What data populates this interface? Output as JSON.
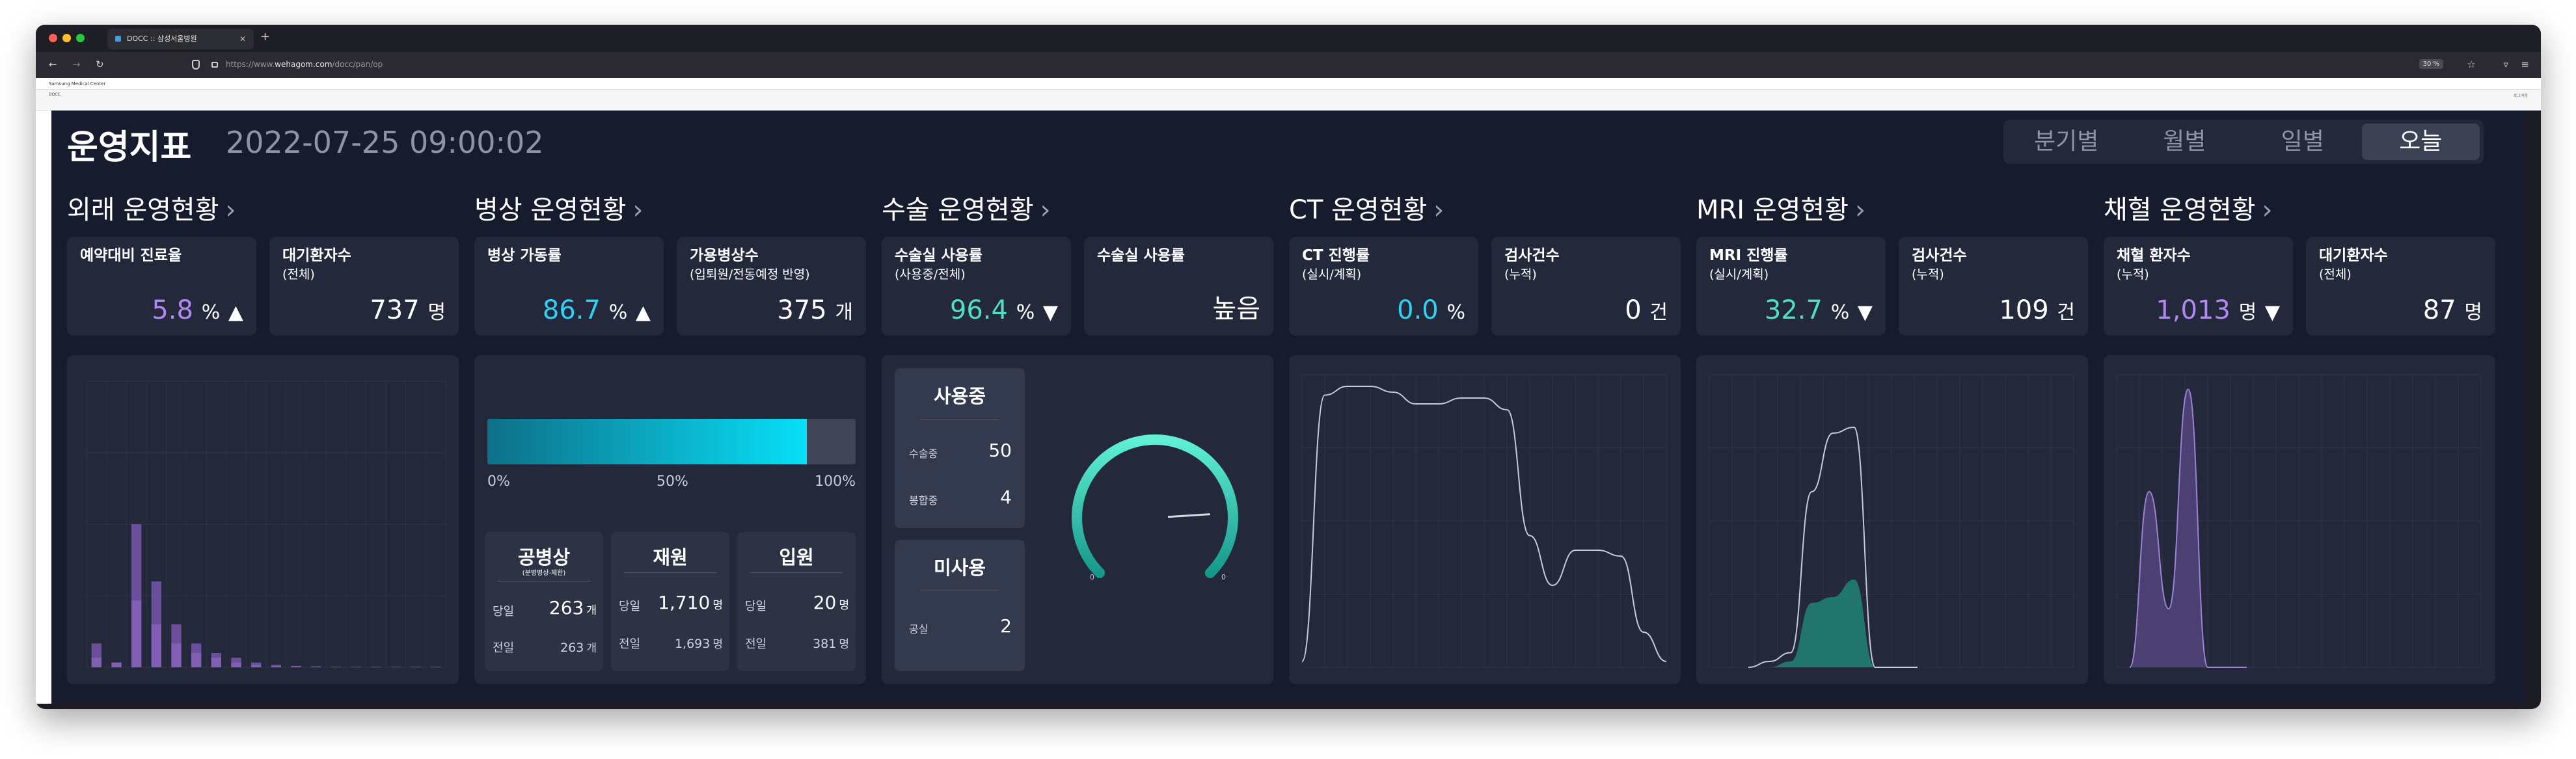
{
  "browser": {
    "tab_title": "DOCC :: 삼성서울병원",
    "url_prefix": "https://www.",
    "url_domain": "wehagom.com",
    "url_path": "/docc/pan/op",
    "zoom": "30 %"
  },
  "strips": {
    "top_left": "Samsung Medical Center",
    "sub_left": "DOCC",
    "sub_right": "로그아웃"
  },
  "header": {
    "title": "운영지표",
    "datetime": "2022-07-25 09:00:02",
    "periods": [
      "분기별",
      "월별",
      "일별",
      "오늘"
    ],
    "active_period": "오늘"
  },
  "sections": {
    "outpatient": {
      "title": "외래 운영현황",
      "card1": {
        "label": "예약대비 진료율",
        "value": "5.8",
        "unit": "%",
        "trend": "▲"
      },
      "card2": {
        "label": "대기환자수",
        "sub": "(전체)",
        "value": "737",
        "unit": "명"
      }
    },
    "ward": {
      "title": "병상 운영현황",
      "card1": {
        "label": "병상 가동률",
        "value": "86.7",
        "unit": "%",
        "trend": "▲"
      },
      "card2": {
        "label": "가용병상수",
        "sub": "(입퇴원/전동예정 반영)",
        "value": "375",
        "unit": "개"
      },
      "bar": {
        "value_pct": 86.7,
        "labels": [
          "0%",
          "50%",
          "100%"
        ]
      },
      "boxes": [
        {
          "title": "공병상",
          "subtitle": "(분병병상-제한)",
          "row1_label": "당일",
          "row1_value": "263",
          "row1_unit": "개",
          "row2_label": "전일",
          "row2_value": "263",
          "row2_unit": "개"
        },
        {
          "title": "재원",
          "subtitle": "",
          "row1_label": "당일",
          "row1_value": "1,710",
          "row1_unit": "명",
          "row2_label": "전일",
          "row2_value": "1,693",
          "row2_unit": "명"
        },
        {
          "title": "입원",
          "subtitle": "",
          "row1_label": "당일",
          "row1_value": "20",
          "row1_unit": "명",
          "row2_label": "전일",
          "row2_value": "381",
          "row2_unit": "명"
        }
      ]
    },
    "surgery": {
      "title": "수술 운영현황",
      "card1": {
        "label": "수술실 사용률",
        "sub": "(사용중/전체)",
        "value": "96.4",
        "unit": "%",
        "trend": "▼"
      },
      "card2": {
        "label": "수술실 사용률",
        "value": "높음"
      },
      "in_use": {
        "title": "사용중",
        "rows": [
          {
            "label": "수술중",
            "value": "50"
          },
          {
            "label": "봉합중",
            "value": "4"
          }
        ]
      },
      "unused": {
        "title": "미사용",
        "rows": [
          {
            "label": "공실",
            "value": "2"
          }
        ]
      },
      "gauge": {
        "min": "0",
        "max": "0",
        "needle_fraction": 0.82
      }
    },
    "ct": {
      "title": "CT 운영현황",
      "card1": {
        "label": "CT 진행률",
        "sub": "(실시/계획)",
        "value": "0.0",
        "unit": "%"
      },
      "card2": {
        "label": "검사건수",
        "sub": "(누적)",
        "value": "0",
        "unit": "건"
      }
    },
    "mri": {
      "title": "MRI 운영현황",
      "card1": {
        "label": "MRI 진행률",
        "sub": "(실시/계획)",
        "value": "32.7",
        "unit": "%",
        "trend": "▼"
      },
      "card2": {
        "label": "검사건수",
        "sub": "(누적)",
        "value": "109",
        "unit": "건"
      }
    },
    "blood": {
      "title": "채혈 운영현황",
      "card1": {
        "label": "채혈 환자수",
        "sub": "(누적)",
        "value": "1,013",
        "unit": "명",
        "trend": "▼"
      },
      "card2": {
        "label": "대기환자수",
        "sub": "(전체)",
        "value": "87",
        "unit": "명"
      }
    }
  },
  "chart_data": [
    {
      "type": "bar",
      "name_hint": "outpatient",
      "values": [
        5,
        1,
        30,
        18,
        9,
        5,
        3,
        2,
        1,
        0.5,
        0.3,
        0.2,
        0.1,
        0.1,
        0.1,
        0.1,
        0.1,
        0.1
      ],
      "highlight_values": [
        2,
        1,
        14,
        9,
        5,
        3,
        2,
        1,
        0.5,
        0.3,
        0.2,
        0.1,
        0.1,
        0.1,
        0.1,
        0.1,
        0.1,
        0.1
      ],
      "ylim": [
        0,
        60
      ]
    },
    {
      "type": "line",
      "name_hint": "ct",
      "x": [
        0,
        1,
        2,
        3,
        4,
        5,
        6,
        7,
        8,
        9,
        10,
        11,
        12,
        13,
        14,
        15,
        16
      ],
      "y": [
        2,
        93,
        96,
        96,
        94,
        90,
        90,
        92,
        92,
        88,
        45,
        28,
        40,
        40,
        38,
        12,
        2
      ],
      "ylim": [
        0,
        100
      ]
    },
    {
      "type": "area",
      "name_hint": "mri",
      "x": [
        0,
        1,
        2,
        3,
        4,
        5,
        6,
        7,
        8
      ],
      "y": [
        0,
        0,
        2,
        22,
        24,
        30,
        0,
        0,
        0
      ],
      "line_y": [
        0,
        2,
        5,
        60,
        80,
        82,
        0,
        0,
        0
      ],
      "ylim": [
        0,
        100
      ]
    },
    {
      "type": "area",
      "name_hint": "blood",
      "x": [
        0,
        1,
        2,
        3,
        4,
        5,
        6
      ],
      "y": [
        0,
        60,
        20,
        95,
        0,
        0,
        0
      ],
      "ylim": [
        0,
        100
      ]
    }
  ],
  "colors": {
    "background": "#171b2e",
    "card": "#23283b",
    "purple": "#b388f5",
    "cyan": "#2fd1f5",
    "teal": "#4fe0c0"
  }
}
